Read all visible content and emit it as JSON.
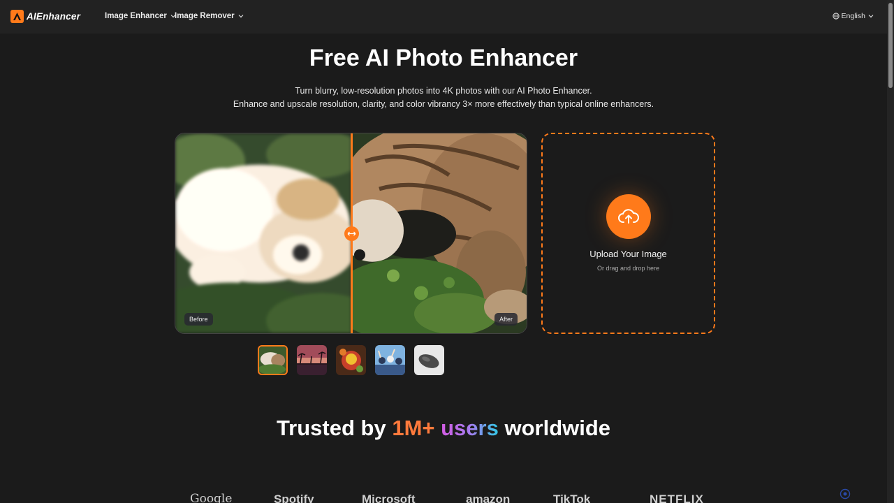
{
  "nav": {
    "logo_text": "AIEnhancer",
    "logo_mark": "A",
    "items": [
      {
        "label": "Image Enhancer"
      },
      {
        "label": "Image Remover"
      }
    ],
    "language": "English"
  },
  "hero": {
    "title": "Free AI Photo Enhancer",
    "subtitle_line1": "Turn blurry, low-resolution photos into 4K photos with our AI Photo Enhancer.",
    "subtitle_line2": "Enhance and upscale resolution, clarity, and color vibrancy 3× more effectively than typical online enhancers."
  },
  "compare": {
    "before_label": "Before",
    "after_label": "After",
    "divider_position": 0.5
  },
  "thumbnails": [
    {
      "name": "cat-dog",
      "active": true
    },
    {
      "name": "sunset-palms",
      "active": false
    },
    {
      "name": "cartoon",
      "active": false
    },
    {
      "name": "crowd",
      "active": false
    },
    {
      "name": "mouse",
      "active": false
    }
  ],
  "upload": {
    "title": "Upload Your Image",
    "hint": "Or drag and drop here"
  },
  "trusted": {
    "prefix": "Trusted by ",
    "highlight1": "1M+",
    "highlight2": "users",
    "suffix": " worldwide"
  },
  "brands": [
    "Google",
    "Spotify",
    "Microsoft",
    "amazon",
    "TikTok",
    "NETFLIX"
  ],
  "colors": {
    "accent": "#ff7a1a",
    "background": "#1b1b1b",
    "navbar": "#222222"
  }
}
